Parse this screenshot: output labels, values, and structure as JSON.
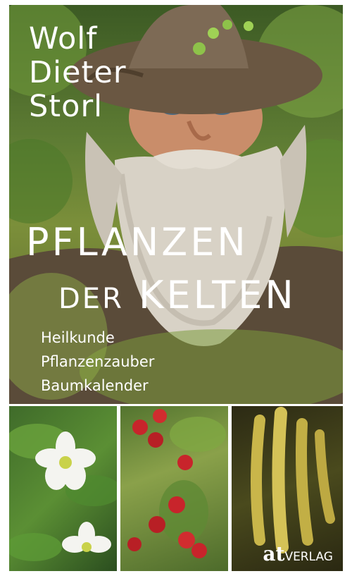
{
  "author": {
    "line1": "Wolf",
    "line2": "Dieter",
    "line3": "Storl"
  },
  "title": {
    "line1": "PFLANZEN",
    "line2_small": "DER",
    "line2_big": "KELTEN"
  },
  "subtitle": [
    "Heilkunde",
    "Pflanzenzauber",
    "Baumkalender"
  ],
  "publisher": {
    "at": "at",
    "verlag": "VERLAG"
  },
  "colors": {
    "text": "#ffffff",
    "background": "#ffffff"
  }
}
